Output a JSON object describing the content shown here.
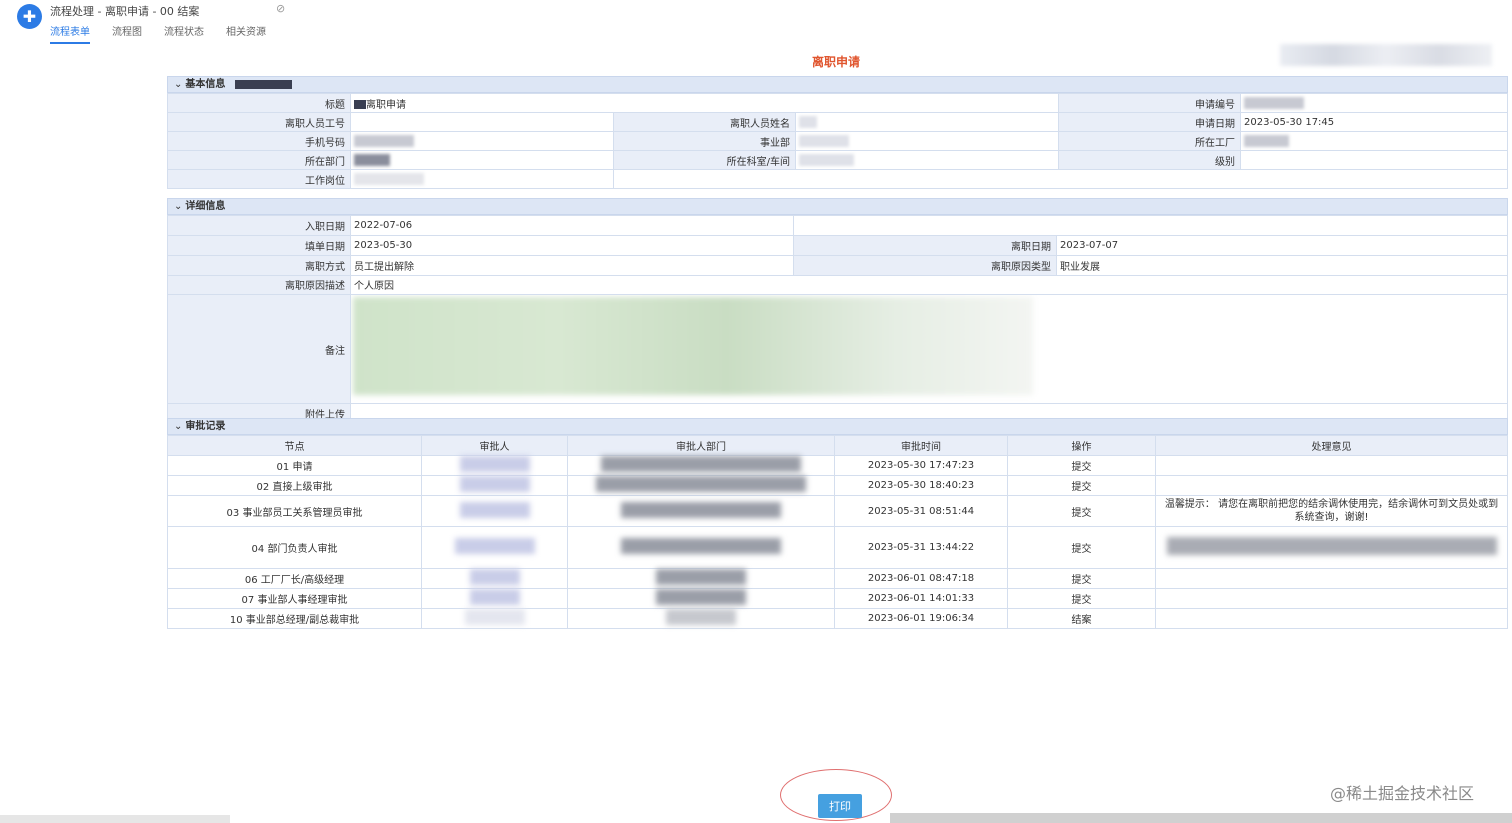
{
  "window": {
    "title": "流程处理 - 离职申请 - 00 结案",
    "tabs": [
      "流程表单",
      "流程图",
      "流程状态",
      "相关资源"
    ]
  },
  "form": {
    "title": "离职申请",
    "basic_section": "基本信息",
    "basic": {
      "title_label": "标题",
      "title_value": "离职申请",
      "apply_no_label": "申请编号",
      "emp_no_label": "离职人员工号",
      "name_label": "离职人员姓名",
      "apply_date_label": "申请日期",
      "apply_date_value": "2023-05-30 17:45",
      "phone_label": "手机号码",
      "division_label": "事业部",
      "factory_label": "所在工厂",
      "dept_label": "所在部门",
      "section_label": "所在科室/车间",
      "level_label": "级别",
      "position_label": "工作岗位"
    },
    "detail_section": "详细信息",
    "detail": {
      "entry_date_label": "入职日期",
      "entry_date_value": "2022-07-06",
      "fill_date_label": "填单日期",
      "fill_date_value": "2023-05-30",
      "leave_date_label": "离职日期",
      "leave_date_value": "2023-07-07",
      "leave_way_label": "离职方式",
      "leave_way_value": "员工提出解除",
      "reason_type_label": "离职原因类型",
      "reason_type_value": "职业发展",
      "reason_desc_label": "离职原因描述",
      "reason_desc_value": "个人原因",
      "remark_label": "备注",
      "attach_label": "附件上传"
    },
    "approval_section": "审批记录",
    "approval": {
      "headers": [
        "节点",
        "审批人",
        "审批人部门",
        "审批时间",
        "操作",
        "处理意见"
      ],
      "rows": [
        {
          "node": "01 申请",
          "time": "2023-05-30 17:47:23",
          "op": "提交",
          "opinion": ""
        },
        {
          "node": "02 直接上级审批",
          "time": "2023-05-30 18:40:23",
          "op": "提交",
          "opinion": ""
        },
        {
          "node": "03 事业部员工关系管理员审批",
          "time": "2023-05-31 08:51:44",
          "op": "提交",
          "opinion": "温馨提示：          请您在离职前把您的结余调休使用完，结余调休可到文员处或到系统查询，谢谢!"
        },
        {
          "node": "04 部门负责人审批",
          "time": "2023-05-31 13:44:22",
          "op": "提交",
          "opinion": ""
        },
        {
          "node": "06 工厂厂长/高级经理",
          "time": "2023-06-01 08:47:18",
          "op": "提交",
          "opinion": ""
        },
        {
          "node": "07 事业部人事经理审批",
          "time": "2023-06-01 14:01:33",
          "op": "提交",
          "opinion": ""
        },
        {
          "node": "10 事业部总经理/副总裁审批",
          "time": "2023-06-01 19:06:34",
          "op": "结案",
          "opinion": ""
        }
      ]
    }
  },
  "actions": {
    "print_label": "打印"
  },
  "watermark": "@稀土掘金技术社区",
  "colors": {
    "accent": "#2c7be5",
    "title": "#e0552e",
    "section_bg": "#dde6f5",
    "print_button": "#45a0e0"
  }
}
